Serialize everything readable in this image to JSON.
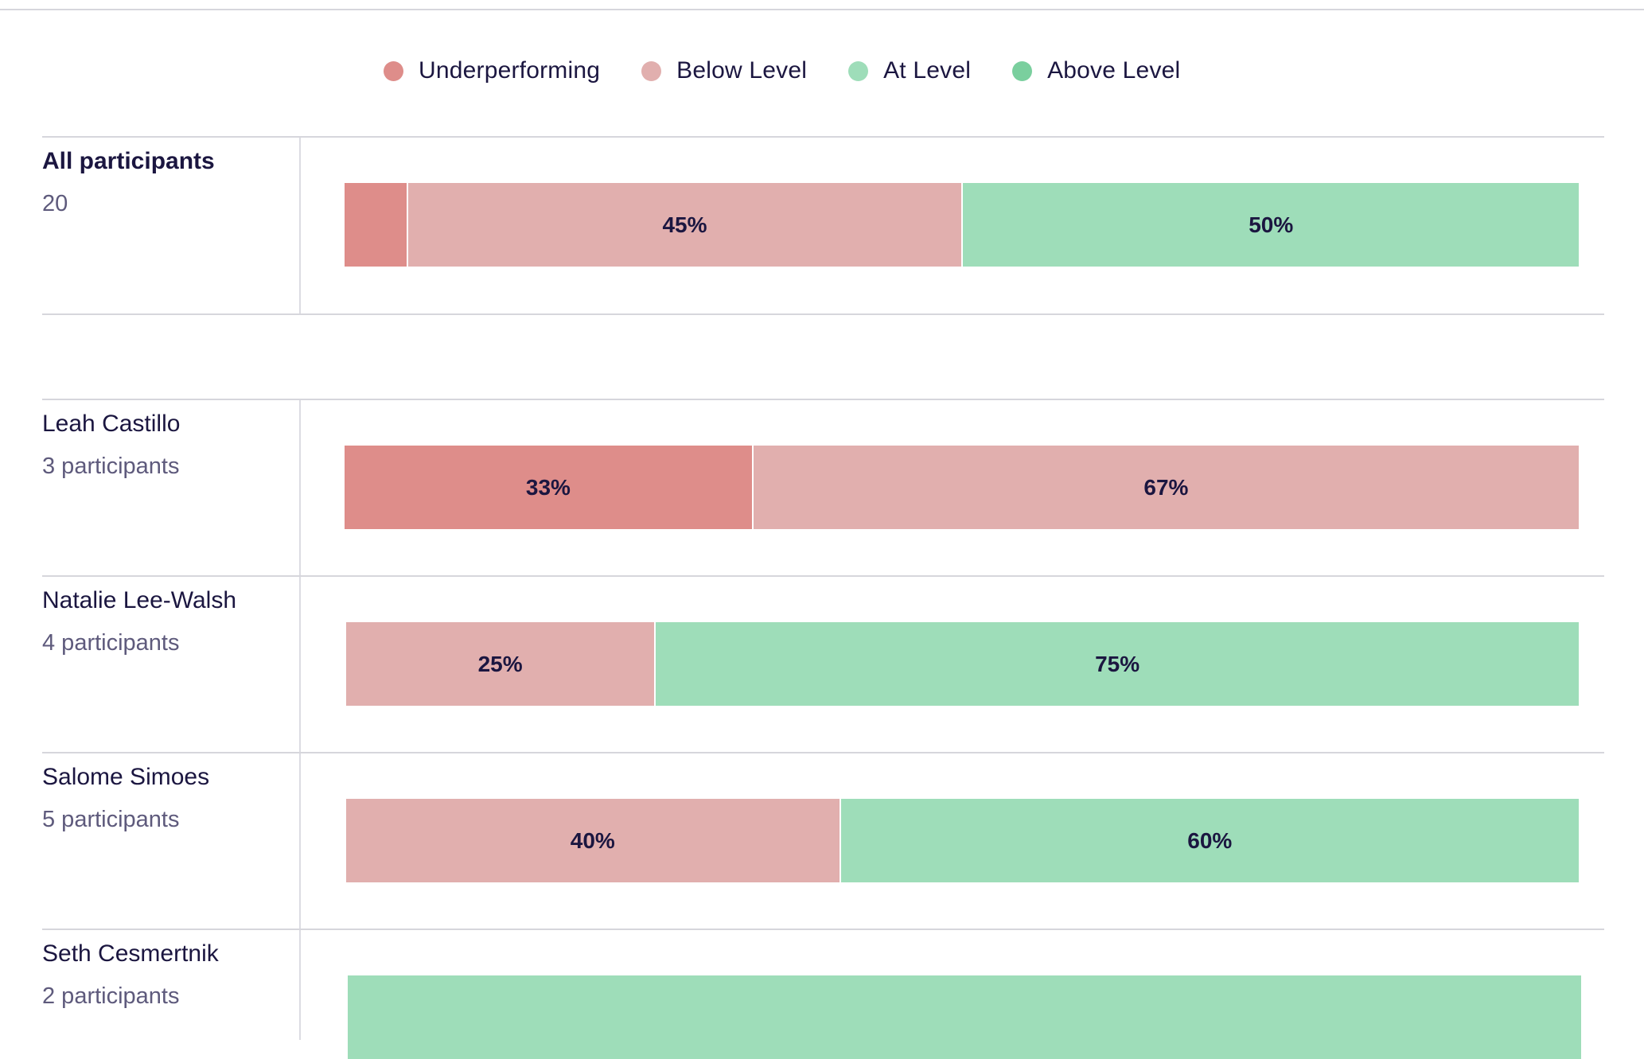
{
  "colors": {
    "underperforming": "#de8d8a",
    "below_level": "#e1afae",
    "at_level": "#9eddb9",
    "above_level": "#7acf9e",
    "text": "#1b1640",
    "subtext": "#5e5a7c",
    "rule": "#d6d6dc"
  },
  "legend": [
    {
      "key": "underperforming",
      "label": "Underperforming"
    },
    {
      "key": "below_level",
      "label": "Below Level"
    },
    {
      "key": "at_level",
      "label": "At Level"
    },
    {
      "key": "above_level",
      "label": "Above Level"
    }
  ],
  "chart_data": {
    "type": "bar",
    "orientation": "horizontal",
    "stacked": "percent",
    "legend_position": "top-center",
    "series_names": [
      "Underperforming",
      "Below Level",
      "At Level",
      "Above Level"
    ],
    "rows": [
      {
        "name": "All participants",
        "count_label": "20",
        "emphasis": true,
        "segments": [
          {
            "key": "underperforming",
            "value": 5,
            "label": ""
          },
          {
            "key": "below_level",
            "value": 45,
            "label": "45%"
          },
          {
            "key": "at_level",
            "value": 50,
            "label": "50%"
          }
        ]
      },
      {
        "name": "Leah Castillo",
        "count_label": "3 participants",
        "segments": [
          {
            "key": "underperforming",
            "value": 33,
            "label": "33%"
          },
          {
            "key": "below_level",
            "value": 67,
            "label": "67%"
          }
        ]
      },
      {
        "name": "Natalie Lee-Walsh",
        "count_label": "4 participants",
        "segments": [
          {
            "key": "below_level",
            "value": 25,
            "label": "25%"
          },
          {
            "key": "at_level",
            "value": 75,
            "label": "75%"
          }
        ]
      },
      {
        "name": "Salome Simoes",
        "count_label": "5 participants",
        "segments": [
          {
            "key": "below_level",
            "value": 40,
            "label": "40%"
          },
          {
            "key": "at_level",
            "value": 60,
            "label": "60%"
          }
        ]
      },
      {
        "name": "Seth Cesmertnik",
        "count_label": "2 participants",
        "segments": [
          {
            "key": "at_level",
            "value": 100,
            "label": ""
          }
        ]
      }
    ]
  }
}
